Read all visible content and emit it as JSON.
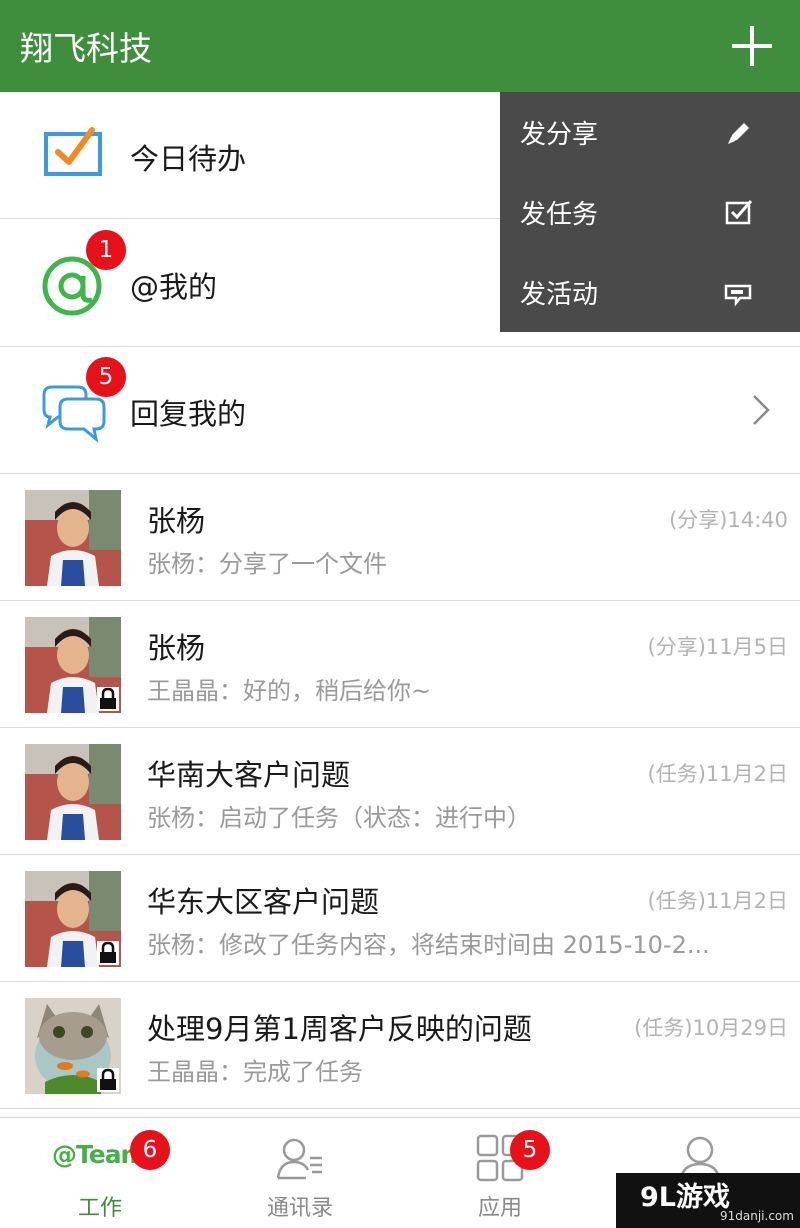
{
  "header": {
    "title": "翔飞科技",
    "add_icon": "plus-icon"
  },
  "shortcuts": [
    {
      "label": "今日待办",
      "icon": "todo-check-icon",
      "badge": ""
    },
    {
      "label": "@我的",
      "icon": "at-icon",
      "badge": "1"
    },
    {
      "label": "回复我的",
      "icon": "chat-bubbles-icon",
      "badge": "5"
    }
  ],
  "dropdown": [
    {
      "label": "发分享",
      "icon": "pencil-icon"
    },
    {
      "label": "发任务",
      "icon": "checkbox-icon"
    },
    {
      "label": "发活动",
      "icon": "megaphone-icon"
    }
  ],
  "feed": [
    {
      "name": "张杨",
      "meta": "(分享)14:40",
      "preview": "张杨：分享了一个文件",
      "locked": false
    },
    {
      "name": "张杨",
      "meta": "(分享)11月5日",
      "preview": "王晶晶：好的，稍后给你~",
      "locked": true
    },
    {
      "name": "华南大客户问题",
      "meta": "(任务)11月2日",
      "preview": "张杨：启动了任务（状态：进行中）",
      "locked": false
    },
    {
      "name": "华东大区客户问题",
      "meta": "(任务)11月2日",
      "preview": "张杨：修改了任务内容，将结束时间由 2015-10-2...",
      "locked": true
    },
    {
      "name": "处理9月第1周客户反映的问题",
      "meta": "(任务)10月29日",
      "preview": "王晶晶：完成了任务",
      "locked": true
    }
  ],
  "tabs": [
    {
      "label": "工作",
      "logo": "@Team",
      "badge": "6",
      "active": true
    },
    {
      "label": "通讯录",
      "badge": "",
      "active": false
    },
    {
      "label": "应用",
      "badge": "5",
      "active": false
    },
    {
      "label": "",
      "badge": "",
      "active": false
    }
  ],
  "watermark": {
    "main": "9L游戏",
    "sub": "91danji.com"
  },
  "colors": {
    "brand_green": "#3f8e3e",
    "badge_red": "#e8111a",
    "menu_bg": "#4a4a4a"
  }
}
